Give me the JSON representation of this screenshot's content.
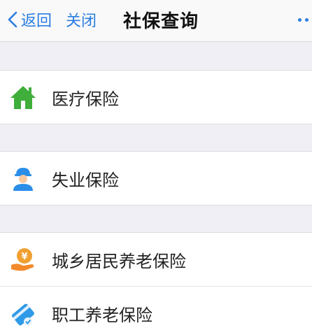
{
  "navbar": {
    "back_label": "返回",
    "close_label": "关闭",
    "title": "社保查询"
  },
  "items": [
    {
      "label": "医疗保险",
      "icon": "house-icon",
      "icon_color": "#3fae3a"
    },
    {
      "label": "失业保险",
      "icon": "worker-icon",
      "icon_color": "#2a8ee8"
    },
    {
      "label": "城乡居民养老保险",
      "icon": "pension-coin-icon",
      "icon_color": "#f0a030"
    },
    {
      "label": "职工养老保险",
      "icon": "card-icon",
      "icon_color": "#2f9ae8"
    }
  ],
  "colors": {
    "accent": "#2a7de1",
    "background": "#f0eff5"
  }
}
